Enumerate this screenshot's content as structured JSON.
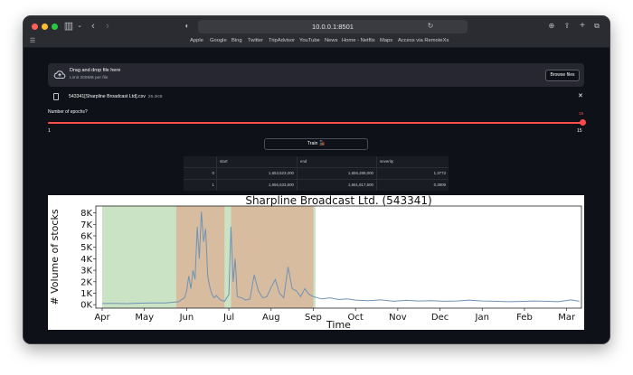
{
  "browser": {
    "url": "10.0.0.1:8501",
    "bookmarks": [
      "Apple",
      "Google",
      "Bing",
      "Twitter",
      "TripAdvisor",
      "YouTube",
      "News",
      "Home - Netflix",
      "Maps",
      "Access via RemoteXs"
    ]
  },
  "uploader": {
    "title": "Drag and drop file here",
    "subtitle": "Limit 200MB per file",
    "browse_label": "Browse files",
    "file_name": "543341[Sharpline Broadcast Ltd].csv",
    "file_size": "25.2KB",
    "close_glyph": "✕"
  },
  "slider": {
    "label": "Number of epochs?",
    "value": "15",
    "min": "1",
    "max": "15",
    "level": 1.0
  },
  "train_button": "Train 🚂",
  "results_table": {
    "columns": [
      "",
      "start",
      "end",
      "severity"
    ],
    "rows": [
      [
        "0",
        "1,653,523,200",
        "1,656,288,000",
        "1.3773"
      ],
      [
        "1",
        "1,656,633,600",
        "1,661,817,600",
        "0.3909"
      ]
    ]
  },
  "chart_data": {
    "type": "line",
    "title": "Sharpline Broadcast Ltd. (543341)",
    "xlabel": "Time",
    "ylabel": "# Volume of stocks",
    "yticks": [
      "0K",
      "1K",
      "2K",
      "3K",
      "4K",
      "5K",
      "6K",
      "7K",
      "8K"
    ],
    "ylim": [
      -300,
      8600
    ],
    "xticks": [
      "Apr",
      "May",
      "Jun",
      "Jul",
      "Aug",
      "Sep",
      "Oct",
      "Nov",
      "Dec",
      "Jan",
      "Feb",
      "Mar"
    ],
    "xlim": [
      -0.15,
      11.35
    ],
    "line_color": "#6f93b5",
    "series": [
      {
        "x": [
          0,
          0.3,
          0.6,
          0.9,
          1.2,
          1.5,
          1.8,
          1.95,
          2.0,
          2.05,
          2.1,
          2.15,
          2.2,
          2.25,
          2.3,
          2.35,
          2.4,
          2.45,
          2.5,
          2.55,
          2.6,
          2.65,
          2.7,
          2.8,
          2.9,
          3.0,
          3.05,
          3.1,
          3.15,
          3.2,
          3.3,
          3.4,
          3.5,
          3.6,
          3.7,
          3.8,
          3.9,
          4.0,
          4.1,
          4.2,
          4.3,
          4.4,
          4.5,
          4.6,
          4.7,
          4.8,
          4.9,
          5.0,
          5.2,
          5.4,
          5.6,
          5.8,
          6.0,
          6.3,
          6.6,
          6.9,
          7.2,
          7.5,
          7.8,
          8.1,
          8.4,
          8.7,
          9.0,
          9.3,
          9.6,
          9.9,
          10.2,
          10.5,
          10.8,
          11.1,
          11.3
        ],
        "y": [
          100,
          120,
          90,
          130,
          150,
          160,
          250,
          600,
          1200,
          2500,
          1400,
          3000,
          2200,
          6800,
          4000,
          8100,
          5500,
          6600,
          2500,
          1500,
          900,
          600,
          800,
          400,
          300,
          900,
          6800,
          2000,
          4000,
          700,
          600,
          400,
          500,
          2600,
          1200,
          600,
          700,
          1500,
          2200,
          1000,
          600,
          3300,
          1400,
          1200,
          700,
          1400,
          900,
          700,
          500,
          600,
          450,
          500,
          400,
          350,
          420,
          300,
          380,
          320,
          350,
          300,
          320,
          400,
          320,
          300,
          260,
          280,
          320,
          300,
          260,
          420,
          300
        ]
      }
    ],
    "anomaly_regions": [
      {
        "start": 0,
        "end": 1.75,
        "color": "#c9e3c4"
      },
      {
        "start": 1.75,
        "end": 2.9,
        "color": "#d7bca0"
      },
      {
        "start": 2.9,
        "end": 3.05,
        "color": "#c9e3c4"
      },
      {
        "start": 3.05,
        "end": 5.0,
        "color": "#d7bca0"
      },
      {
        "start": 5.0,
        "end": 5.05,
        "color": "#c9e3c4"
      }
    ]
  }
}
